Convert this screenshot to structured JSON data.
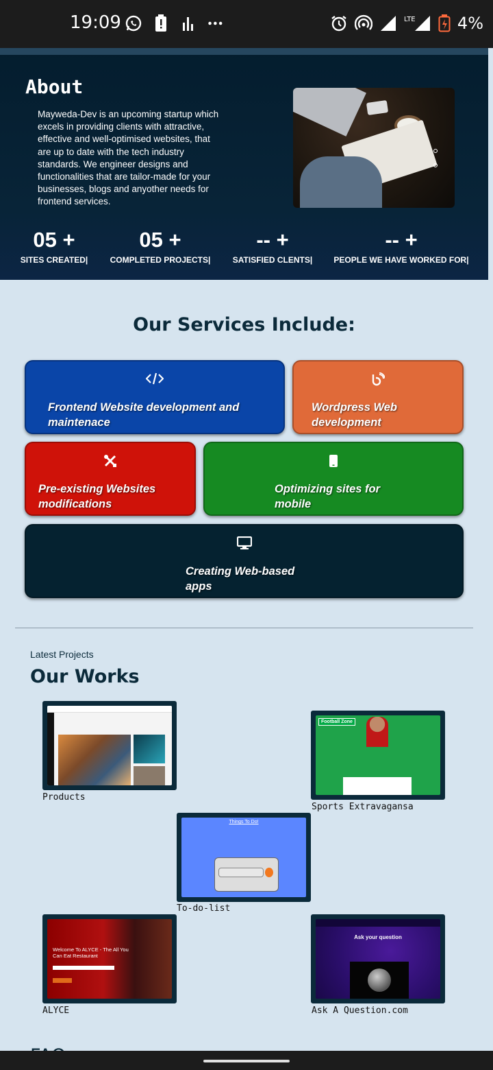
{
  "status_bar": {
    "time": "19:09",
    "network": "LTE",
    "battery_percent": "4%",
    "icons_left": [
      "whatsapp-icon",
      "battery-alert-icon",
      "signal-bars-icon",
      "more-dots-icon"
    ],
    "icons_right": [
      "alarm-icon",
      "hotspot-icon",
      "cell-signal-icon",
      "battery-low-icon"
    ]
  },
  "about": {
    "title": "About",
    "text": "Mayweda-Dev is an upcoming startup which excels in providing clients with attractive, effective and well-optimised websites, that are up to date with the tech industry standards. We engineer designs and functionalities that are tailor-made for your businesses, blogs and anyother needs for frontend services.",
    "stats": [
      {
        "value": "05 +",
        "label": "SITES CREATED|"
      },
      {
        "value": "05 +",
        "label": "COMPLETED PROJECTS|"
      },
      {
        "value": "-- +",
        "label": "SATISFIED CLENTS|"
      },
      {
        "value": "-- +",
        "label": "PEOPLE WE HAVE WORKED FOR|"
      }
    ]
  },
  "services": {
    "title": "Our Services Include:",
    "items": [
      {
        "label": "Frontend Website development and maintenace",
        "icon": "code-icon",
        "color": "#0a45a8"
      },
      {
        "label": "Wordpress Web development",
        "icon": "wordpress-icon",
        "color": "#e06a39"
      },
      {
        "label": "Pre-existing Websites modifications",
        "icon": "tools-icon",
        "color": "#cf1209"
      },
      {
        "label": "Optimizing sites for mobile",
        "icon": "mobile-icon",
        "color": "#168a22"
      },
      {
        "label": "Creating Web-based apps",
        "icon": "desktop-icon",
        "color": "#052230"
      }
    ]
  },
  "works": {
    "subtitle": "Latest Projects",
    "title": "Our Works",
    "projects": [
      {
        "caption": "Products"
      },
      {
        "caption": "Sports Extravagansa",
        "thumb_title": "Football Zone"
      },
      {
        "caption": "To-do-list",
        "thumb_title": "Things To Do!"
      },
      {
        "caption": "ALYCE",
        "thumb_title": "Welcome To ALYCE - The All You Can Eat Restaurant"
      },
      {
        "caption": "Ask A Question.com",
        "thumb_title": "Ask your question"
      }
    ]
  },
  "next_section_peek": "FAQ"
}
